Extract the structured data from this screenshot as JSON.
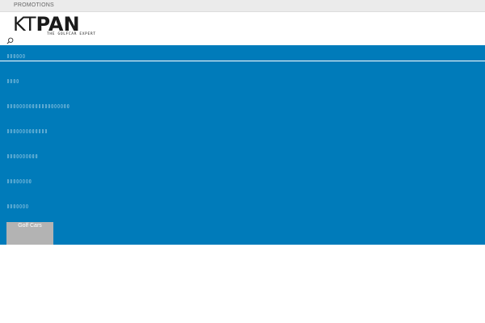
{
  "topbar": {
    "promotions_label": "PROMOTIONS"
  },
  "logo": {
    "brand_kt": "KT",
    "brand_pan": "PAN",
    "tagline": "THE GOLFCAR EXPERT"
  },
  "header": {
    "search_icon": "search-icon"
  },
  "menu": {
    "background": "#007bba",
    "items": [
      {
        "label": "▯▯▯▯▯▯"
      },
      {
        "label": "▯▯▯▯"
      },
      {
        "label": "▯▯▯▯▯▯▯▯▯▯▯▯▯▯▯▯▯▯▯▯"
      },
      {
        "label": "▯▯▯▯▯▯▯▯▯▯▯▯▯"
      },
      {
        "label": "▯▯▯▯▯▯▯▯▯▯"
      },
      {
        "label": "▯▯▯▯▯▯▯▯"
      },
      {
        "label": "▯▯▯▯▯▯▯"
      }
    ],
    "card": {
      "label": "Golf Cars"
    }
  }
}
